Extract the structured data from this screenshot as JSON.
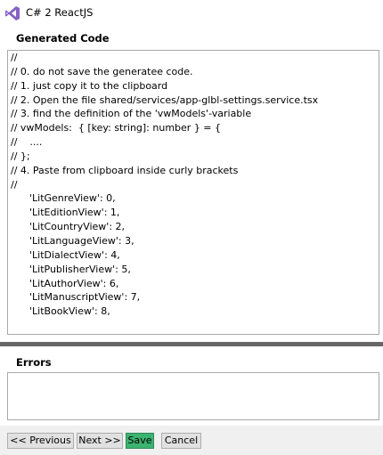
{
  "window": {
    "title": "C# 2 ReactJS"
  },
  "generated_code": {
    "label": "Generated Code",
    "lines": [
      "//",
      "// 0. do not save the generatee code.",
      "// 1. just copy it to the clipboard",
      "// 2. Open the file shared/services/app-glbl-settings.service.tsx",
      "// 3. find the definition of the 'vwModels'-variable",
      "// vwModels:  { [key: string]: number } = {",
      "//    ....",
      "// };",
      "// 4. Paste from clipboard inside curly brackets",
      "//",
      "      'LitGenreView': 0,",
      "      'LitEditionView': 1,",
      "      'LitCountryView': 2,",
      "      'LitLanguageView': 3,",
      "      'LitDialectView': 4,",
      "      'LitPublisherView': 5,",
      "      'LitAuthorView': 6,",
      "      'LitManuscriptView': 7,",
      "      'LitBookView': 8,",
      ""
    ]
  },
  "errors": {
    "label": "Errors",
    "value": ""
  },
  "buttons": {
    "previous": "<< Previous",
    "next": "Next >>",
    "save": "Save",
    "cancel": "Cancel"
  },
  "colors": {
    "save_button": "#3cb371",
    "splitter": "#686868",
    "bottom_bar": "#f0f0f0",
    "vs_icon": "#8661c5"
  },
  "icons": {
    "app": "visual-studio-icon"
  }
}
